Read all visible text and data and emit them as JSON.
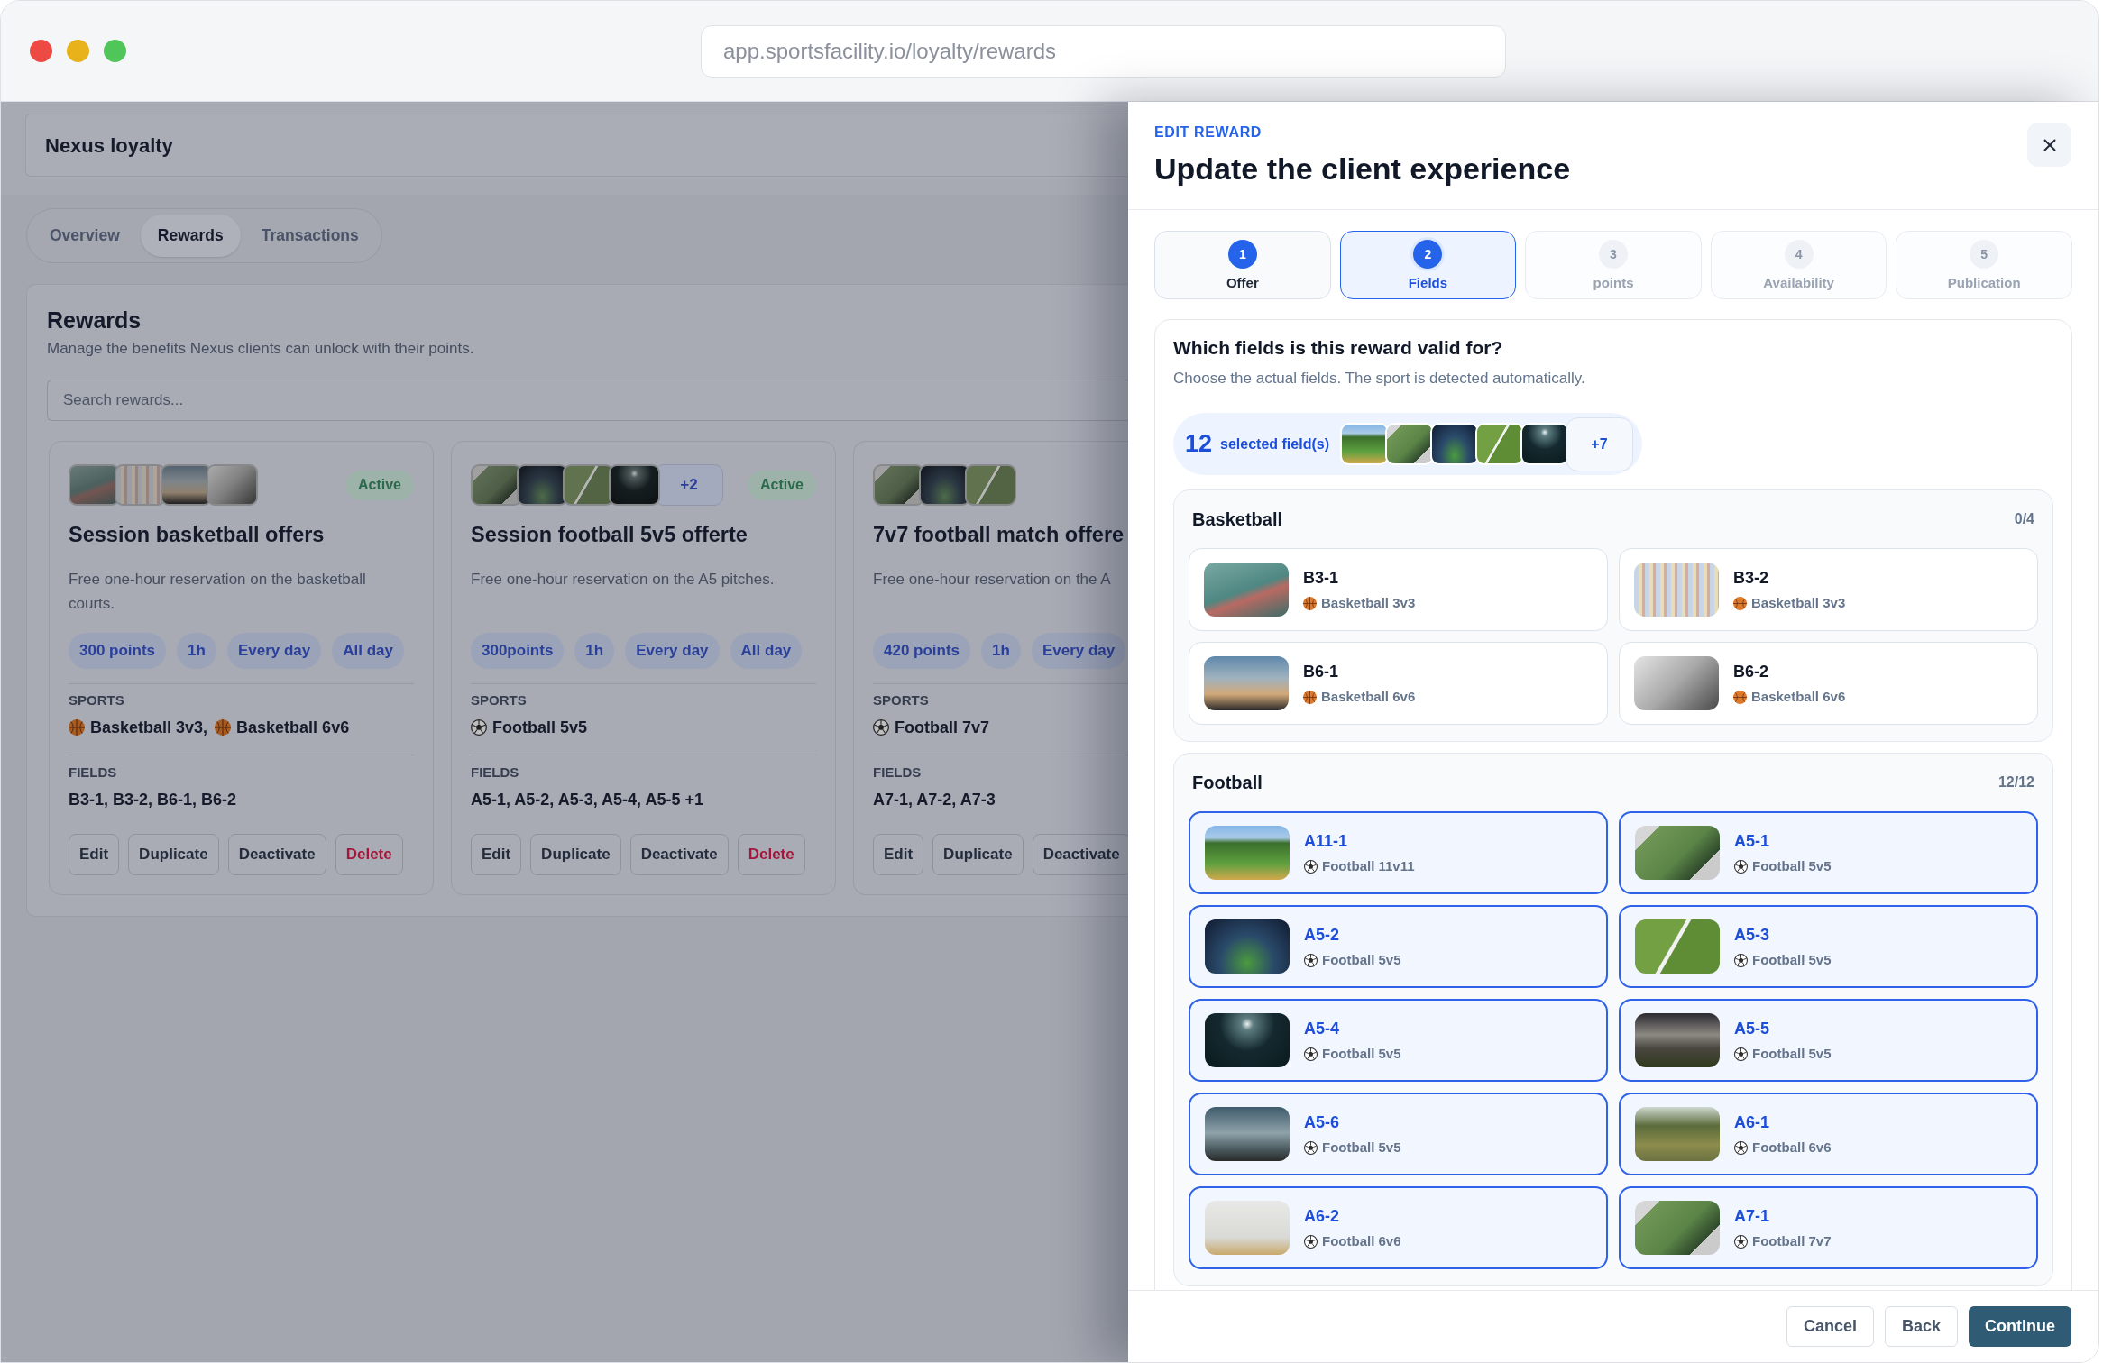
{
  "browser": {
    "url": "app.sportsfacility.io/loyalty/rewards"
  },
  "page": {
    "title": "Nexus loyalty",
    "tabs": [
      {
        "label": "Overview",
        "selected": false
      },
      {
        "label": "Rewards",
        "selected": true
      },
      {
        "label": "Transactions",
        "selected": false
      }
    ],
    "rewards": {
      "title": "Rewards",
      "subtitle": "Manage the benefits Nexus clients can unlock with their points.",
      "search": {
        "placeholder": "Search rewards..."
      },
      "cards": [
        {
          "thumbnails": [
            {
              "kind": "court"
            },
            {
              "kind": "tower"
            },
            {
              "kind": "palms"
            },
            {
              "kind": "hoop"
            }
          ],
          "status": "Active",
          "title": "Session basketball offers",
          "description": "Free one-hour reservation on the basketball courts.",
          "chips": [
            "300 points",
            "1h",
            "Every day",
            "All day"
          ],
          "sports_label": "SPORTS",
          "sports": [
            {
              "kind": "basketball",
              "label": "Basketball 3v3,"
            },
            {
              "kind": "basketball",
              "label": "Basketball 6v6"
            }
          ],
          "fields_label": "FIELDS",
          "fields": "B3-1, B3-2, B6-1, B6-2",
          "actions": [
            {
              "label": "Edit",
              "kind": "default"
            },
            {
              "label": "Duplicate",
              "kind": "default"
            },
            {
              "label": "Deactivate",
              "kind": "default"
            },
            {
              "label": "Delete",
              "kind": "danger"
            }
          ]
        },
        {
          "thumbnails": [
            {
              "kind": "aerial"
            },
            {
              "kind": "stadium"
            },
            {
              "kind": "corner"
            },
            {
              "kind": "night"
            }
          ],
          "more": "+2",
          "status": "Active",
          "title": "Session football 5v5 offerte",
          "description": "Free one-hour reservation on the A5 pitches.",
          "chips": [
            "300points",
            "1h",
            "Every day",
            "All day"
          ],
          "sports_label": "SPORTS",
          "sports": [
            {
              "kind": "football",
              "label": "Football 5v5"
            }
          ],
          "fields_label": "FIELDS",
          "fields": "A5-1, A5-2, A5-3, A5-4, A5-5 +1",
          "actions": [
            {
              "label": "Edit",
              "kind": "default"
            },
            {
              "label": "Duplicate",
              "kind": "default"
            },
            {
              "label": "Deactivate",
              "kind": "default"
            },
            {
              "label": "Delete",
              "kind": "danger"
            }
          ]
        },
        {
          "thumbnails": [
            {
              "kind": "aerial"
            },
            {
              "kind": "stadium"
            },
            {
              "kind": "corner"
            }
          ],
          "title": "7v7 football match offere",
          "description": "Free one-hour reservation on the A",
          "chips": [
            "420 points",
            "1h",
            "Every day"
          ],
          "sports_label": "SPORTS",
          "sports": [
            {
              "kind": "football",
              "label": "Football 7v7"
            }
          ],
          "fields_label": "FIELDS",
          "fields": "A7-1, A7-2, A7-3",
          "actions": [
            {
              "label": "Edit",
              "kind": "default"
            },
            {
              "label": "Duplicate",
              "kind": "default"
            },
            {
              "label": "Deactivate",
              "kind": "default"
            }
          ]
        }
      ]
    }
  },
  "drawer": {
    "eyebrow": "EDIT REWARD",
    "title": "Update the client experience",
    "steps": [
      {
        "number": "1",
        "label": "Offer",
        "completed": true,
        "selected": false
      },
      {
        "number": "2",
        "label": "Fields",
        "completed": false,
        "selected": true
      },
      {
        "number": "3",
        "label": "points",
        "completed": false,
        "selected": false
      },
      {
        "number": "4",
        "label": "Availability",
        "completed": false,
        "selected": false
      },
      {
        "number": "5",
        "label": "Publication",
        "completed": false,
        "selected": false
      }
    ],
    "question": "Which fields is this reward valid for?",
    "hint": "Choose the actual fields. The sport is detected automatically.",
    "selection": {
      "count": "12",
      "label": "selected field(s)",
      "thumbnails": [
        {
          "kind": "field"
        },
        {
          "kind": "aerial"
        },
        {
          "kind": "stadium"
        },
        {
          "kind": "corner"
        },
        {
          "kind": "night"
        }
      ],
      "more": "+7"
    },
    "sections": [
      {
        "kind": "basketball",
        "title": "Basketball",
        "count": "0/4",
        "fields": [
          {
            "name": "B3-1",
            "sport": "Basketball 3v3",
            "photo": {
              "kind": "court"
            },
            "selected": false
          },
          {
            "name": "B3-2",
            "sport": "Basketball 3v3",
            "photo": {
              "kind": "tower"
            },
            "selected": false
          },
          {
            "name": "B6-1",
            "sport": "Basketball 6v6",
            "photo": {
              "kind": "palms"
            },
            "selected": false
          },
          {
            "name": "B6-2",
            "sport": "Basketball 6v6",
            "photo": {
              "kind": "hoop"
            },
            "selected": false
          }
        ]
      },
      {
        "kind": "football",
        "title": "Football",
        "count": "12/12",
        "fields": [
          {
            "name": "A11-1",
            "sport": "Football 11v11",
            "photo": {
              "kind": "field"
            },
            "selected": true
          },
          {
            "name": "A5-1",
            "sport": "Football 5v5",
            "photo": {
              "kind": "aerial"
            },
            "selected": true
          },
          {
            "name": "A5-2",
            "sport": "Football 5v5",
            "photo": {
              "kind": "stadium"
            },
            "selected": true
          },
          {
            "name": "A5-3",
            "sport": "Football 5v5",
            "photo": {
              "kind": "corner"
            },
            "selected": true
          },
          {
            "name": "A5-4",
            "sport": "Football 5v5",
            "photo": {
              "kind": "night"
            },
            "selected": true
          },
          {
            "name": "A5-5",
            "sport": "Football 5v5",
            "photo": {
              "kind": "dusk"
            },
            "selected": true
          },
          {
            "name": "A5-6",
            "sport": "Football 5v5",
            "photo": {
              "kind": "clouds"
            },
            "selected": true
          },
          {
            "name": "A6-1",
            "sport": "Football 6v6",
            "photo": {
              "kind": "meadow"
            },
            "selected": true
          },
          {
            "name": "A6-2",
            "sport": "Football 6v6",
            "photo": {
              "kind": "fog"
            },
            "selected": true
          },
          {
            "name": "A7-1",
            "sport": "Football 7v7",
            "photo": {
              "kind": "aerial"
            },
            "selected": true
          }
        ]
      }
    ],
    "footer": {
      "buttons": [
        {
          "label": "Cancel",
          "kind": "secondary"
        },
        {
          "label": "Back",
          "kind": "secondary"
        },
        {
          "label": "Continue",
          "kind": "primary"
        }
      ]
    }
  }
}
